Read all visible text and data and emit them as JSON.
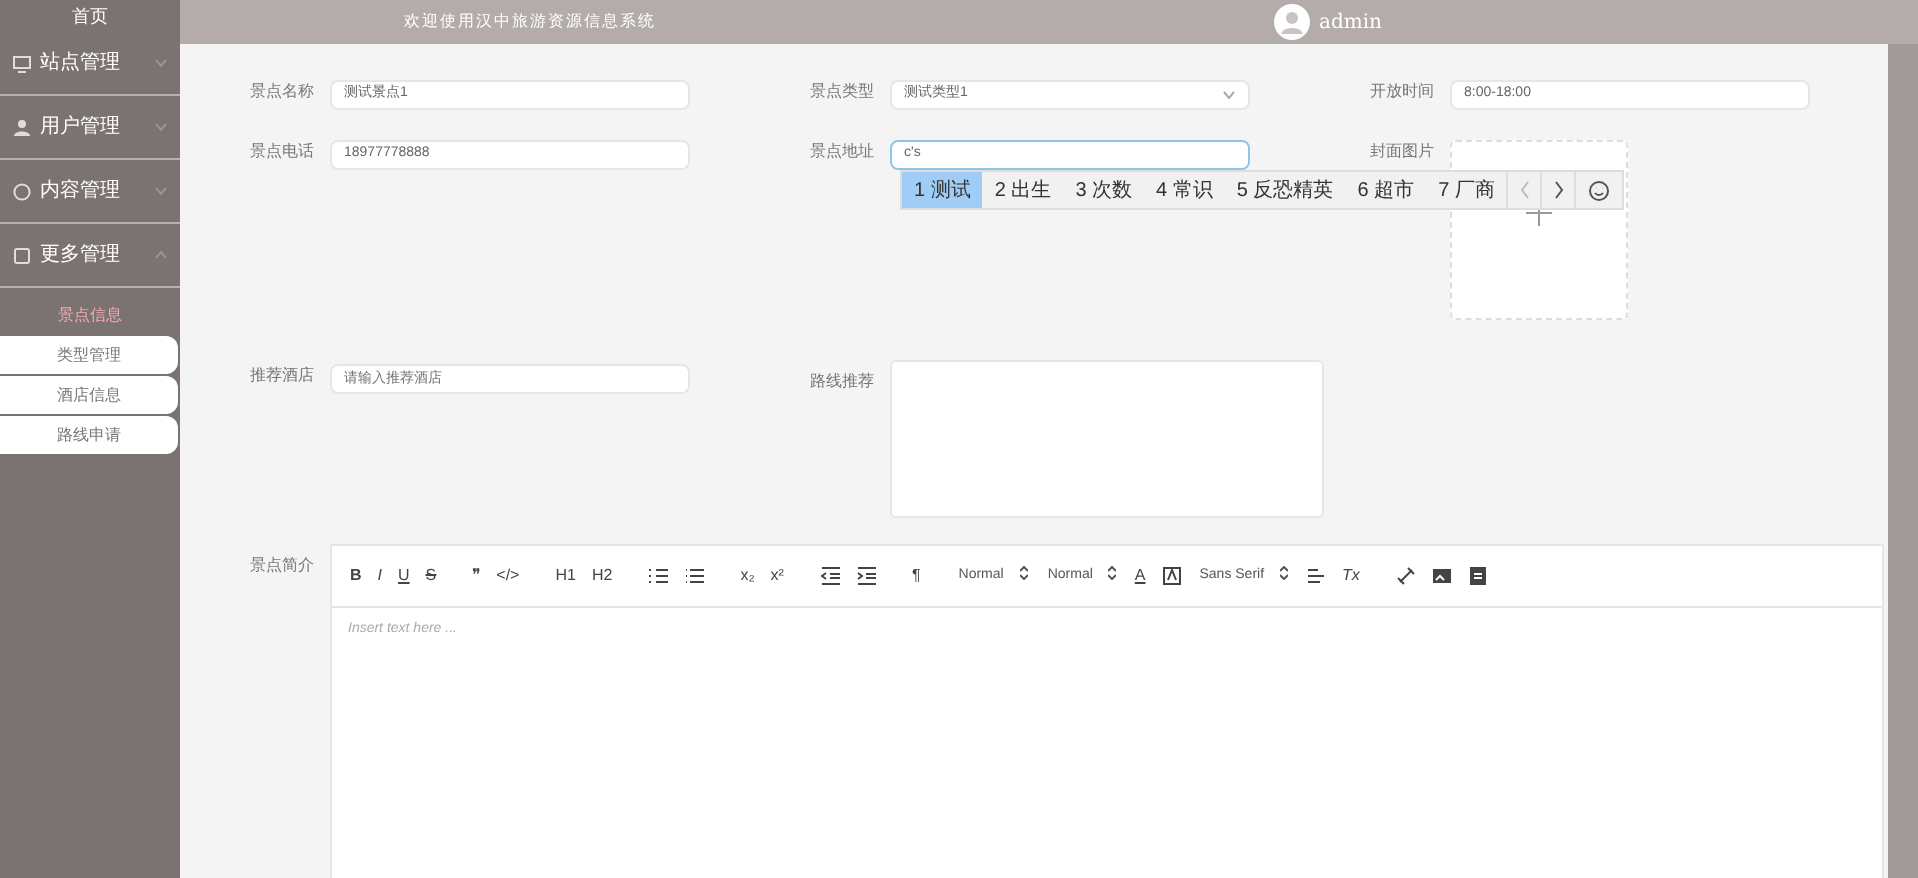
{
  "sidebar": {
    "home": "首页",
    "menus": [
      {
        "label": "站点管理",
        "expanded": false
      },
      {
        "label": "用户管理",
        "expanded": false
      },
      {
        "label": "内容管理",
        "expanded": false
      },
      {
        "label": "更多管理",
        "expanded": true,
        "children": [
          {
            "label": "景点信息",
            "selected": true
          },
          {
            "label": "类型管理",
            "selected": false
          },
          {
            "label": "酒店信息",
            "selected": false
          },
          {
            "label": "路线申请",
            "selected": false
          }
        ]
      }
    ]
  },
  "header": {
    "title": "欢迎使用汉中旅游资源信息系统",
    "user": "admin"
  },
  "form": {
    "name": {
      "label": "景点名称",
      "value": "测试景点1"
    },
    "type": {
      "label": "景点类型",
      "value": "测试类型1"
    },
    "open_time": {
      "label": "开放时间",
      "value": "8:00-18:00"
    },
    "phone": {
      "label": "景点电话",
      "value": "18977778888"
    },
    "address": {
      "label": "景点地址",
      "value": "c's"
    },
    "cover": {
      "label": "封面图片"
    },
    "hotel": {
      "label": "推荐酒店",
      "placeholder": "请输入推荐酒店"
    },
    "route": {
      "label": "路线推荐"
    },
    "intro": {
      "label": "景点简介",
      "placeholder": "Insert text here ...",
      "toolbar": [
        {
          "kind": "bold",
          "text": "B"
        },
        {
          "kind": "italic",
          "text": "I"
        },
        {
          "kind": "underline",
          "text": "U"
        },
        {
          "kind": "strike",
          "text": "S"
        },
        {
          "kind": "gap"
        },
        {
          "kind": "text",
          "text": "❞"
        },
        {
          "kind": "text",
          "text": "</>"
        },
        {
          "kind": "gap"
        },
        {
          "kind": "text",
          "text": "H1"
        },
        {
          "kind": "text",
          "text": "H2"
        },
        {
          "kind": "gap"
        },
        {
          "kind": "ol"
        },
        {
          "kind": "ul"
        },
        {
          "kind": "gap"
        },
        {
          "kind": "text",
          "text": "x₂"
        },
        {
          "kind": "text",
          "text": "x²"
        },
        {
          "kind": "gap"
        },
        {
          "kind": "outdent"
        },
        {
          "kind": "indent"
        },
        {
          "kind": "gap"
        },
        {
          "kind": "text",
          "text": "¶"
        },
        {
          "kind": "gap"
        },
        {
          "kind": "select",
          "text": "Normal"
        },
        {
          "kind": "select",
          "text": "Normal"
        },
        {
          "kind": "underline",
          "text": "A"
        },
        {
          "kind": "background"
        },
        {
          "kind": "select",
          "text": "Sans Serif"
        },
        {
          "kind": "align"
        },
        {
          "kind": "italic",
          "text": "Tx"
        },
        {
          "kind": "gap"
        },
        {
          "kind": "link"
        },
        {
          "kind": "image"
        },
        {
          "kind": "video"
        }
      ]
    }
  },
  "ime": {
    "candidates": [
      {
        "number": "1",
        "word": "测试",
        "selected": true
      },
      {
        "number": "2",
        "word": "出生",
        "selected": false
      },
      {
        "number": "3",
        "word": "次数",
        "selected": false
      },
      {
        "number": "4",
        "word": "常识",
        "selected": false
      },
      {
        "number": "5",
        "word": "反恐精英",
        "selected": false
      },
      {
        "number": "6",
        "word": "超市",
        "selected": false
      },
      {
        "number": "7",
        "word": "厂商",
        "selected": false
      }
    ]
  }
}
